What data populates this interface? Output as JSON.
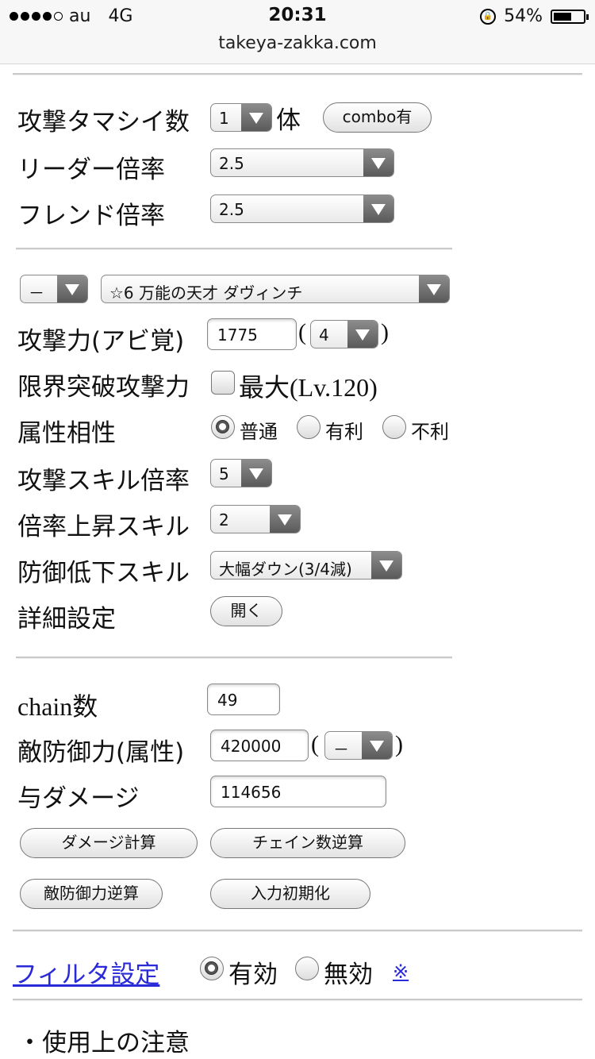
{
  "status_bar": {
    "carrier": "au",
    "network": "4G",
    "time": "20:31",
    "battery": "54%",
    "url": "takeya-zakka.com"
  },
  "form": {
    "attack_souls": {
      "label": "攻撃タマシイ数",
      "value": "1",
      "unit": "体",
      "combo_button": "combo有"
    },
    "leader_mult": {
      "label": "リーダー倍率",
      "value": "2.5"
    },
    "friend_mult": {
      "label": "フレンド倍率",
      "value": "2.5"
    },
    "character": {
      "attr_value": "－",
      "name_value": "☆6 万能の天才 ダヴィンチ"
    },
    "attack_power": {
      "label": "攻撃力(アビ覚)",
      "value": "1775",
      "paren_open": "(",
      "awaken_value": "4",
      "paren_close": ")"
    },
    "limit_break": {
      "label": "限界突破攻撃力",
      "checkbox_label": "最大(Lv.120)"
    },
    "affinity": {
      "label": "属性相性",
      "options": [
        "普通",
        "有利",
        "不利"
      ],
      "selected": "普通"
    },
    "skill_mult": {
      "label": "攻撃スキル倍率",
      "value": "5"
    },
    "mult_up_skill": {
      "label": "倍率上昇スキル",
      "value": "2"
    },
    "def_down_skill": {
      "label": "防御低下スキル",
      "value": "大幅ダウン(3/4減)"
    },
    "detail": {
      "label": "詳細設定",
      "button": "開く"
    }
  },
  "calc": {
    "chain": {
      "label": "chain数",
      "value": "49"
    },
    "enemy_def": {
      "label": "敵防御力(属性)",
      "value": "420000",
      "paren_open": "(",
      "attr_value": "－",
      "paren_close": ")"
    },
    "damage": {
      "label": "与ダメージ",
      "value": "114656"
    },
    "buttons": {
      "damage_calc": "ダメージ計算",
      "chain_reverse": "チェイン数逆算",
      "def_reverse": "敵防御力逆算",
      "reset": "入力初期化"
    }
  },
  "filter": {
    "link": "フィルタ設定",
    "on": "有効",
    "off": "無効",
    "selected": "有効",
    "note": "※"
  },
  "notes": {
    "heading": "・使用上の注意"
  }
}
